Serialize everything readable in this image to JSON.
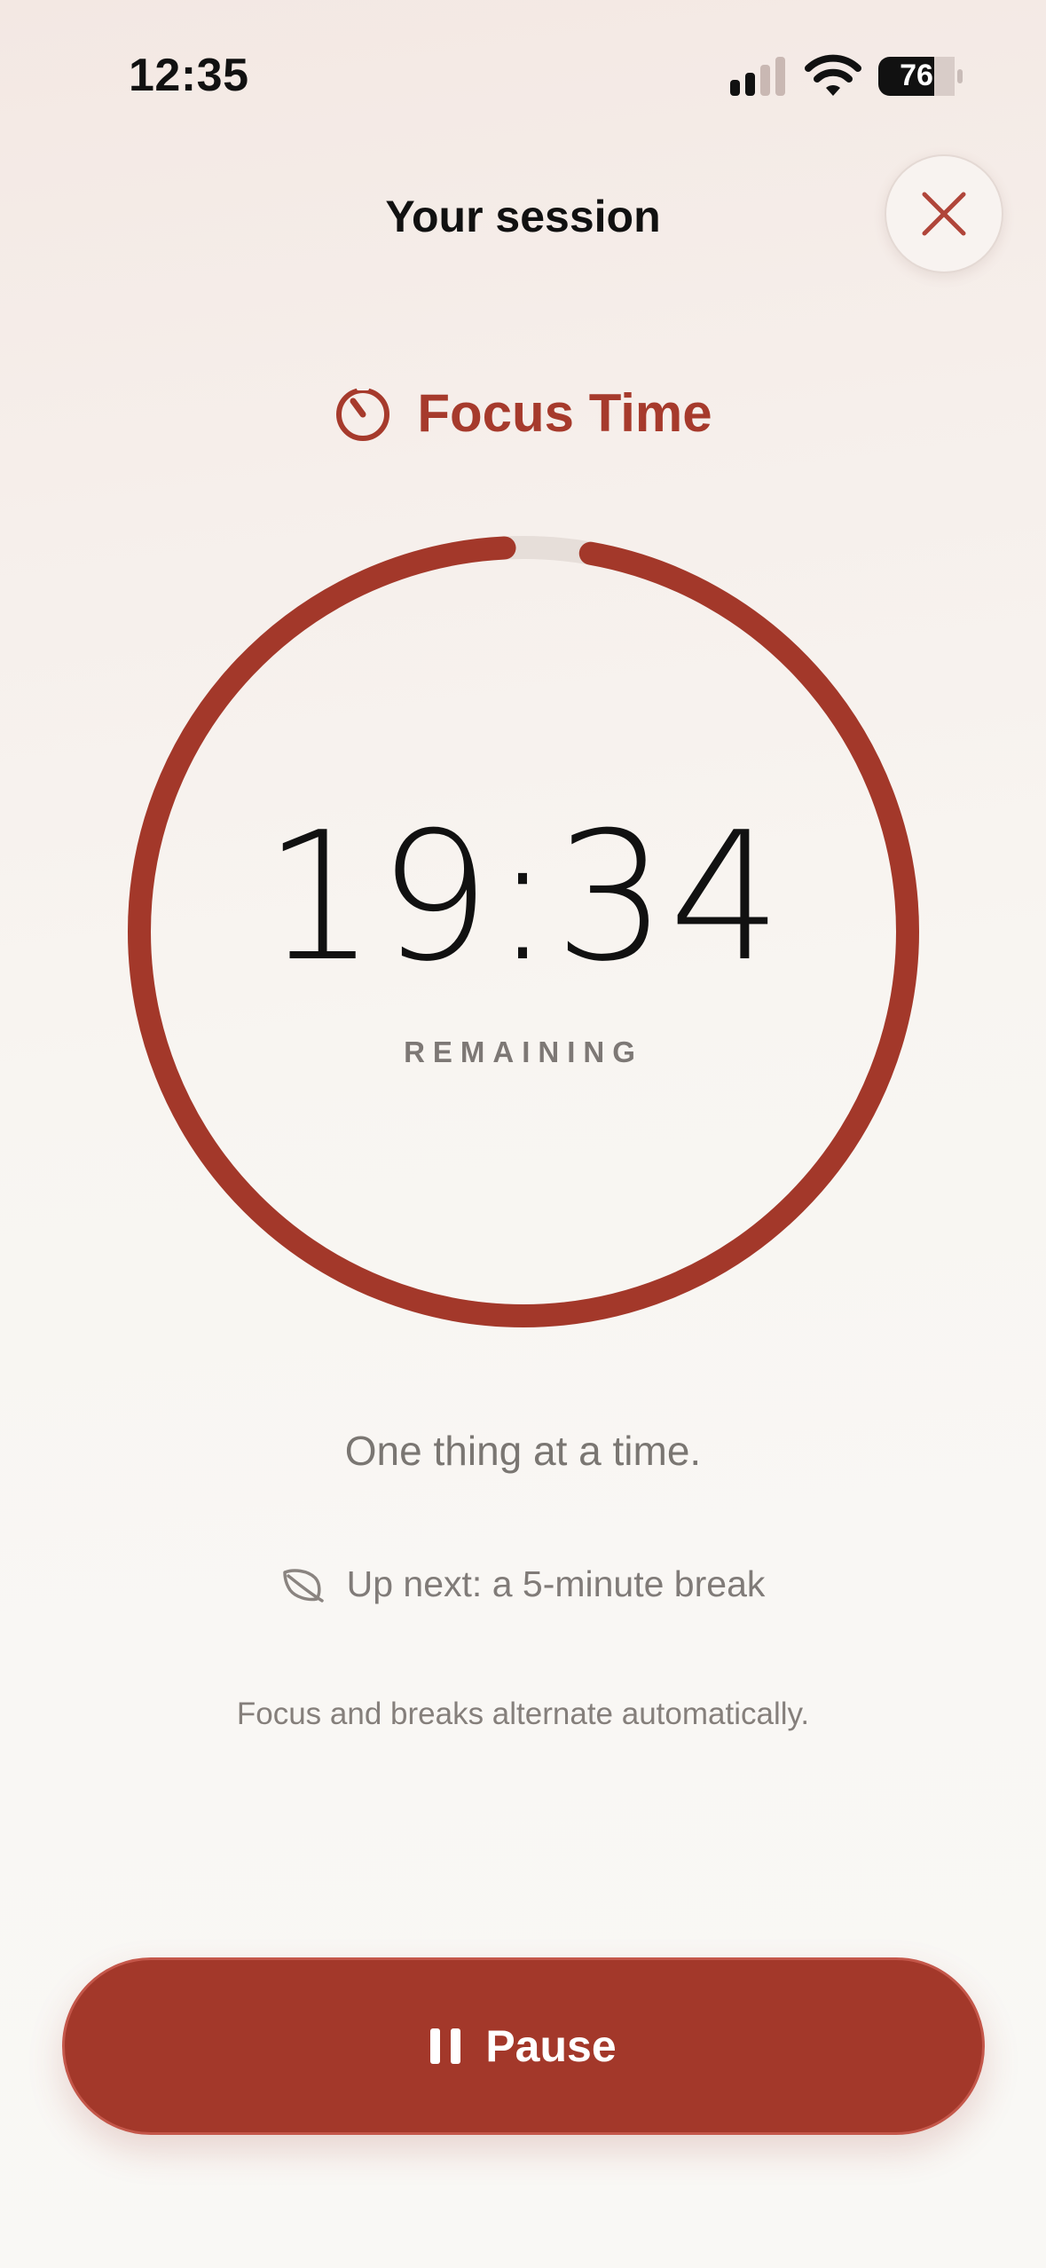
{
  "status_bar": {
    "time": "12:35",
    "battery_level": "76",
    "icons": [
      "signal-icon",
      "wifi-icon",
      "battery-icon"
    ]
  },
  "header": {
    "title": "Your session",
    "close_icon": "close-icon"
  },
  "mode": {
    "label": "Focus Time",
    "icon": "timer-icon"
  },
  "timer": {
    "value": "19:34",
    "caption": "REMAINING",
    "progress_remaining_fraction": 0.98
  },
  "motto": "One thing at a time.",
  "up_next": {
    "icon": "leaf-icon",
    "text": "Up next: a 5-minute break"
  },
  "footnote": "Focus and breaks alternate automatically.",
  "primary_action": {
    "label": "Pause",
    "icon": "pause-icon"
  },
  "colors": {
    "accent": "#a3382a",
    "ring_track": "#e6ded9",
    "background": "#f9f7f4",
    "text_primary": "#111111",
    "text_secondary": "#7a7672"
  }
}
